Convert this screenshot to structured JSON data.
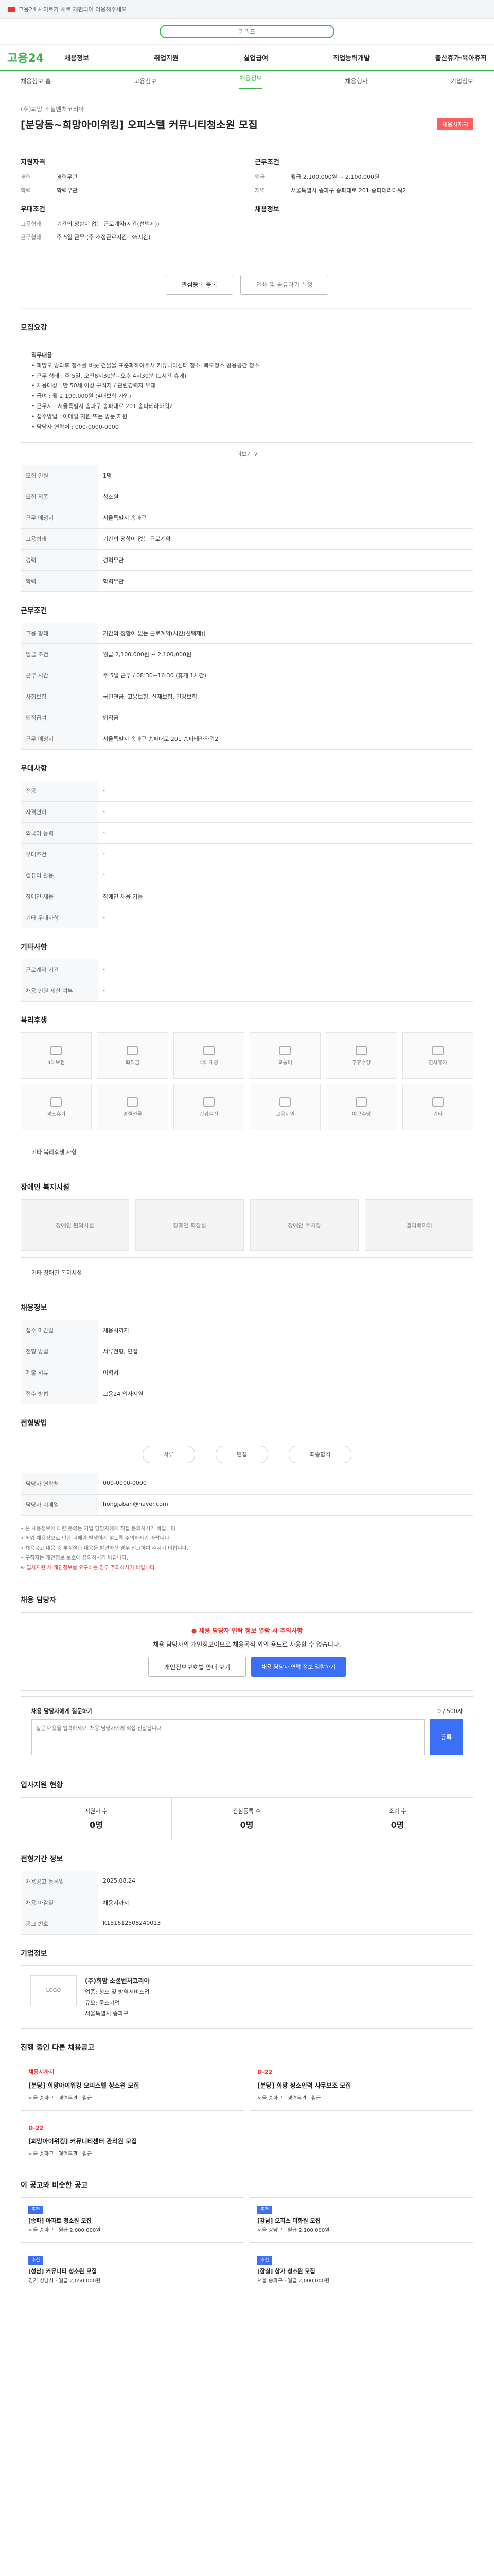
{
  "banner": {
    "text": "고용24 사이트가 새로 개편되어 이용해주세요"
  },
  "search": {
    "placeholder": "키워드"
  },
  "brand": {
    "name": "고용",
    "name_accent": "24"
  },
  "nav": {
    "items": [
      "채용정보",
      "취업지원",
      "실업급여",
      "직업능력개발",
      "출산휴가·육아휴직"
    ]
  },
  "subnav": {
    "items": [
      "채용정보 홈",
      "고용정보",
      "채용정보",
      "채용행사",
      "기업정보"
    ],
    "active": 2
  },
  "job": {
    "company": "(주)희망 소셜벤처코리아",
    "title": "[분당동~희망아이위킹] 오피스텔 커뮤니티청소원 모집",
    "deadline_badge": "채용시까지"
  },
  "summary_left": {
    "heading": "지원자격",
    "rows": [
      {
        "k": "경력",
        "v": "경력무관"
      },
      {
        "k": "학력",
        "v": "학력무관"
      }
    ],
    "heading2": "우대조건",
    "rows2": [
      {
        "k": "고용형태",
        "v": "기간의 정함이 없는 근로계약(시간(선택제))"
      },
      {
        "k": "근무형태",
        "v": "주 5일 근무 (주 소정근로시간: 36시간)"
      }
    ]
  },
  "summary_right": {
    "heading": "근무조건",
    "rows": [
      {
        "k": "임금",
        "v": "월급 2,100,000원 ~ 2,100,000원"
      },
      {
        "k": "지역",
        "v": "서울특별시 송파구 송파대로 201 송파테라타워2"
      }
    ],
    "heading2": "채용정보",
    "rows2": []
  },
  "buttons": {
    "apply": "관심등록 등록",
    "share": "인쇄 및 공유하기 설정"
  },
  "sections": {
    "detail": "모집요강",
    "conditions": "근무조건",
    "welfare": "우대사항",
    "contract": "기타사항",
    "benefits": "복리후생",
    "disability": "장애인 복지시설",
    "screening": "채용정보",
    "process": "전형방법",
    "recruiter": "채용 담당자",
    "qa": "채용 담당자에게 질문하기",
    "status": "입사지원 현황",
    "stats": "전형기간 정보",
    "company": "기업정보",
    "other_jobs": "진행 중인 다른 채용공고",
    "recommend": "이 공고와 비슷한 공고"
  },
  "detail_box": {
    "heading": "직무내용",
    "lines": [
      "• 희망도 방과후 청소를 비롯 건물을 표준화하여주시 커뮤니티센터 청소, 복도청소 공용공간 청소",
      "• 근무 형태 : 주 5일, 오전8시30분~오후 4시30분 (1시간 휴게)",
      "• 채용대상 : 만 50세 이상 구직자 / 관련경력자 우대",
      "• 급여 : 월 2,100,000원 (4대보험 가입)",
      "• 근무지 : 서울특별시 송파구 송파대로 201 송파테라타워2",
      "• 접수방법 : 이메일 지원 또는 방문 지원",
      "• 담당자 연락처 : 000-0000-0000"
    ]
  },
  "info_table": [
    {
      "k": "모집 인원",
      "v": "1명"
    },
    {
      "k": "모집 직종",
      "v": "청소원"
    },
    {
      "k": "근무 예정지",
      "v": "서울특별시 송파구"
    },
    {
      "k": "고용형태",
      "v": "기간의 정함이 없는 근로계약"
    },
    {
      "k": "경력",
      "v": "경력무관"
    },
    {
      "k": "학력",
      "v": "학력무관"
    }
  ],
  "cond_table": [
    {
      "k": "고용 형태",
      "v": "기간의 정함이 없는 근로계약(시간(선택제))"
    },
    {
      "k": "임금 조건",
      "v": "월급 2,100,000원 ~ 2,100,000원"
    },
    {
      "k": "근무 시간",
      "v": "주 5일 근무 / 08:30~16:30 (휴게 1시간)"
    },
    {
      "k": "사회보험",
      "v": "국민연금, 고용보험, 산재보험, 건강보험"
    },
    {
      "k": "퇴직급여",
      "v": "퇴직금"
    },
    {
      "k": "근무 예정지",
      "v": "서울특별시 송파구 송파대로 201 송파테라타워2"
    }
  ],
  "more_label": "더보기 ∨",
  "welfare_table": [
    {
      "k": "전공",
      "v": "-"
    },
    {
      "k": "자격면허",
      "v": "-"
    },
    {
      "k": "외국어 능력",
      "v": "-"
    },
    {
      "k": "우대조건",
      "v": "-"
    },
    {
      "k": "컴퓨터 활용",
      "v": "-"
    },
    {
      "k": "장애인 채용",
      "v": "장애인 채용 가능"
    },
    {
      "k": "기타 우대사항",
      "v": "-"
    }
  ],
  "contract_table": [
    {
      "k": "근로계약 기간",
      "v": "-"
    },
    {
      "k": "채용 인원 제한 여부",
      "v": "-"
    }
  ],
  "benefit_items": [
    "4대보험",
    "퇴직금",
    "식대제공",
    "교통비",
    "주휴수당",
    "연차휴가",
    "경조휴가",
    "명절선물",
    "건강검진",
    "교육지원",
    "야근수당",
    "기타"
  ],
  "benefit_note": "기타 복리후생 사항",
  "disability_items": [
    "장애인 편의시설",
    "장애인 화장실",
    "장애인 주차장",
    "엘리베이터"
  ],
  "disability_note": "기타 장애인 복지시설",
  "screening_table": [
    {
      "k": "접수 마감일",
      "v": "채용시까지"
    },
    {
      "k": "전형 방법",
      "v": "서류전형, 면접"
    },
    {
      "k": "제출 서류",
      "v": "이력서"
    },
    {
      "k": "접수 방법",
      "v": "고용24 입사지원"
    }
  ],
  "process": {
    "steps": [
      "서류",
      "면접",
      "최종합격"
    ]
  },
  "recruiter_table": [
    {
      "k": "담당자 연락처",
      "v": "000-0000-0000"
    },
    {
      "k": "담당자 이메일",
      "v": "hongjaban@naver.com"
    }
  ],
  "notices": [
    "• 본 채용정보에 대한 문의는 기업 담당자에게 직접 문의하시기 바랍니다.",
    "• 허위 채용정보로 인한 피해가 발생하지 않도록 주의하시기 바랍니다.",
    "• 채용공고 내용 중 부적절한 내용을 발견하신 경우 신고하여 주시기 바랍니다.",
    "• 구직자는 개인정보 보호에 유의하시기 바랍니다."
  ],
  "notices_red": "※ 입사지원 시 개인정보를 요구하는 경우 주의하시기 바랍니다.",
  "cta": {
    "warn": "● 채용 담당자 연락 정보 열람 시 주의사항",
    "desc": "채용 담당자의 개인정보이므로 채용목적 외의 용도로 사용할 수 없습니다.",
    "btn1": "개인정보보호법 안내 보기",
    "btn2": "채용 담당자 연락 정보 열람하기"
  },
  "qa": {
    "label": "채용 담당자에게 질문하기",
    "placeholder": "질문 내용을 입력하세요. 채용 담당자에게 직접 전달됩니다.",
    "submit": "등록",
    "counter": "0 / 500자"
  },
  "status": {
    "labels": [
      "지원자 수",
      "관심등록 수",
      "조회 수"
    ],
    "values": [
      "0명",
      "0명",
      "0명"
    ]
  },
  "stats_table": [
    {
      "k": "채용공고 등록일",
      "v": "2025.08.24"
    },
    {
      "k": "채용 마감일",
      "v": "채용시까지"
    },
    {
      "k": "공고 번호",
      "v": "K151612508240013"
    }
  ],
  "company_card": {
    "logo": "LOGO",
    "name": "(주)희망 소셜벤처코리아",
    "industry": "업종: 청소 및 방역서비스업",
    "size": "규모: 중소기업",
    "address": "서울특별시 송파구"
  },
  "other_jobs": [
    {
      "hd": "채용시까지",
      "tt": "[분당] 희망아이위킹 오피스텔 청소원 모집",
      "meta": "서울 송파구 · 경력무관 · 월급"
    },
    {
      "hd": "D-22",
      "tt": "[분당] 희망 청소인력 사무보조 모집",
      "meta": "서울 송파구 · 경력무관 · 월급"
    },
    {
      "hd": "D-22",
      "tt": "[희망아이위킹] 커뮤니티센터 관리원 모집",
      "meta": "서울 송파구 · 경력무관 · 월급"
    }
  ],
  "recommend": [
    {
      "tag": "추천",
      "tt": "[송파] 아파트 청소원 모집",
      "meta": "서울 송파구 · 월급 2,000,000원"
    },
    {
      "tag": "추천",
      "tt": "[강남] 오피스 미화원 모집",
      "meta": "서울 강남구 · 월급 2,100,000원"
    },
    {
      "tag": "추천",
      "tt": "[성남] 커뮤니티 청소원 모집",
      "meta": "경기 성남시 · 월급 2,050,000원"
    },
    {
      "tag": "추천",
      "tt": "[잠실] 상가 청소원 모집",
      "meta": "서울 송파구 · 월급 2,000,000원"
    }
  ]
}
